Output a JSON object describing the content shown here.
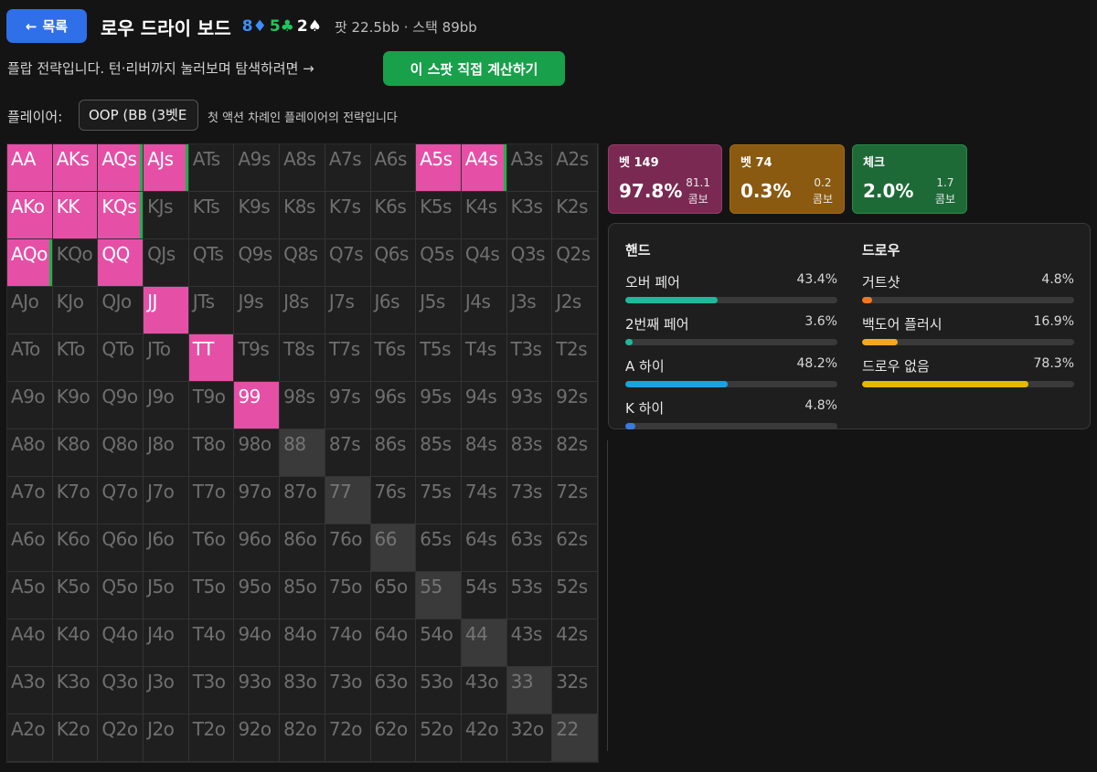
{
  "header": {
    "back_label": "목록",
    "back_arrow": "←",
    "title": "로우 드라이 보드",
    "board": [
      {
        "rank": "8",
        "suit": "♦",
        "suit_class": "card-d"
      },
      {
        "rank": "5",
        "suit": "♣",
        "suit_class": "card-c"
      },
      {
        "rank": "2",
        "suit": "♠",
        "suit_class": "card-s"
      }
    ],
    "pot_stack": "팟 22.5bb · 스택 89bb"
  },
  "intro": {
    "text": "플랍 전략입니다. 턴·리버까지 눌러보며 탐색하려면 →",
    "calc_button": "이 스팟 직접 계산하기"
  },
  "player": {
    "label": "플레이어:",
    "selected": "OOP (BB (3벳E",
    "note": "첫 액션 차례인 플레이어의 전략입니다"
  },
  "grid": {
    "rows": [
      [
        "AA",
        "AKs",
        "AQs",
        "AJs",
        "ATs",
        "A9s",
        "A8s",
        "A7s",
        "A6s",
        "A5s",
        "A4s",
        "A3s",
        "A2s"
      ],
      [
        "AKo",
        "KK",
        "KQs",
        "KJs",
        "KTs",
        "K9s",
        "K8s",
        "K7s",
        "K6s",
        "K5s",
        "K4s",
        "K3s",
        "K2s"
      ],
      [
        "AQo",
        "KQo",
        "QQ",
        "QJs",
        "QTs",
        "Q9s",
        "Q8s",
        "Q7s",
        "Q6s",
        "Q5s",
        "Q4s",
        "Q3s",
        "Q2s"
      ],
      [
        "AJo",
        "KJo",
        "QJo",
        "JJ",
        "JTs",
        "J9s",
        "J8s",
        "J7s",
        "J6s",
        "J5s",
        "J4s",
        "J3s",
        "J2s"
      ],
      [
        "ATo",
        "KTo",
        "QTo",
        "JTo",
        "TT",
        "T9s",
        "T8s",
        "T7s",
        "T6s",
        "T5s",
        "T4s",
        "T3s",
        "T2s"
      ],
      [
        "A9o",
        "K9o",
        "Q9o",
        "J9o",
        "T9o",
        "99",
        "98s",
        "97s",
        "96s",
        "95s",
        "94s",
        "93s",
        "92s"
      ],
      [
        "A8o",
        "K8o",
        "Q8o",
        "J8o",
        "T8o",
        "98o",
        "88",
        "87s",
        "86s",
        "85s",
        "84s",
        "83s",
        "82s"
      ],
      [
        "A7o",
        "K7o",
        "Q7o",
        "J7o",
        "T7o",
        "97o",
        "87o",
        "77",
        "76s",
        "75s",
        "74s",
        "73s",
        "72s"
      ],
      [
        "A6o",
        "K6o",
        "Q6o",
        "J6o",
        "T6o",
        "96o",
        "86o",
        "76o",
        "66",
        "65s",
        "64s",
        "63s",
        "62s"
      ],
      [
        "A5o",
        "K5o",
        "Q5o",
        "J5o",
        "T5o",
        "95o",
        "85o",
        "75o",
        "65o",
        "55",
        "54s",
        "53s",
        "52s"
      ],
      [
        "A4o",
        "K4o",
        "Q4o",
        "J4o",
        "T4o",
        "94o",
        "84o",
        "74o",
        "64o",
        "54o",
        "44",
        "43s",
        "42s"
      ],
      [
        "A3o",
        "K3o",
        "Q3o",
        "J3o",
        "T3o",
        "93o",
        "83o",
        "73o",
        "63o",
        "53o",
        "43o",
        "33",
        "32s"
      ],
      [
        "A2o",
        "K2o",
        "Q2o",
        "J2o",
        "T2o",
        "92o",
        "82o",
        "72o",
        "62o",
        "52o",
        "42o",
        "32o",
        "22"
      ]
    ],
    "bet_hands": [
      "AA",
      "AKs",
      "AQs",
      "AJs",
      "A5s",
      "A4s",
      "AKo",
      "KK",
      "KQs",
      "AQo",
      "QQ",
      "JJ",
      "TT",
      "99"
    ],
    "mixed_check_hands": [
      "AQs",
      "AJs",
      "A4s",
      "KQs",
      "AQo"
    ]
  },
  "actions": [
    {
      "key": "bet149",
      "name": "벳 149",
      "pct": "97.8%",
      "combos": "81.1",
      "combo_label": "콤보",
      "color": "#7a2a52"
    },
    {
      "key": "bet74",
      "name": "벳 74",
      "pct": "0.3%",
      "combos": "0.2",
      "combo_label": "콤보",
      "color": "#8a5a10"
    },
    {
      "key": "check",
      "name": "체크",
      "pct": "2.0%",
      "combos": "1.7",
      "combo_label": "콤보",
      "color": "#1d6a37"
    }
  ],
  "stats": {
    "hand": {
      "title": "핸드",
      "items": [
        {
          "label": "오버 페어",
          "value": "43.4%",
          "pct": 43.4,
          "color": "#1fb89a"
        },
        {
          "label": "2번째 페어",
          "value": "3.6%",
          "pct": 3.6,
          "color": "#1fb89a"
        },
        {
          "label": "A 하이",
          "value": "48.2%",
          "pct": 48.2,
          "color": "#1aa3e0"
        },
        {
          "label": "K 하이",
          "value": "4.8%",
          "pct": 4.8,
          "color": "#3a7ae0"
        }
      ]
    },
    "draw": {
      "title": "드로우",
      "items": [
        {
          "label": "거트샷",
          "value": "4.8%",
          "pct": 4.8,
          "color": "#f07820"
        },
        {
          "label": "백도어 플러시",
          "value": "16.9%",
          "pct": 16.9,
          "color": "#f5a623"
        },
        {
          "label": "드로우 없음",
          "value": "78.3%",
          "pct": 78.3,
          "color": "#e6b800"
        }
      ]
    }
  }
}
